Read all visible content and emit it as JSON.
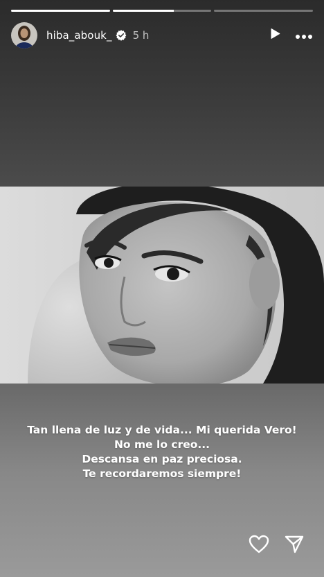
{
  "story": {
    "progress": [
      1.0,
      0.62,
      0.0
    ],
    "username": "hiba_abouk_",
    "time": "5 h",
    "caption": {
      "line1": "Tan llena de luz y de vida... Mi querida Vero!",
      "line2": "No me lo creo...",
      "line3": "Descansa en paz preciosa.",
      "line4": "Te recordaremos siempre!"
    }
  },
  "icons": {
    "avatar": "profile-avatar",
    "verified": "verified-badge-icon",
    "play": "play-icon",
    "more": "more-icon",
    "like": "heart-icon",
    "share": "send-icon"
  }
}
